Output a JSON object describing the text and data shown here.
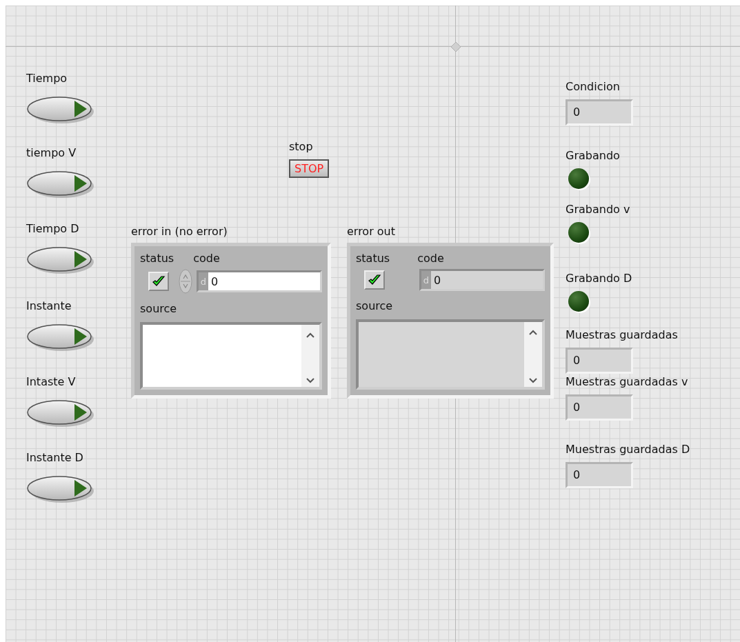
{
  "switches": [
    {
      "label": "Tiempo",
      "on": false
    },
    {
      "label": "tiempo V",
      "on": false
    },
    {
      "label": "Tiempo D",
      "on": false
    },
    {
      "label": "Instante",
      "on": false
    },
    {
      "label": "Intaste V",
      "on": false
    },
    {
      "label": "Instante D",
      "on": false
    }
  ],
  "stop": {
    "label": "stop",
    "text": "STOP"
  },
  "error_clusters": [
    {
      "kind": "control",
      "label": "error in (no error)",
      "status_label": "status",
      "status": true,
      "code_label": "code",
      "radix": "d",
      "code": "0",
      "source_label": "source"
    },
    {
      "kind": "indicator",
      "label": "error out",
      "status_label": "status",
      "status": true,
      "code_label": "code",
      "radix": "d",
      "code": "0",
      "source_label": "source"
    }
  ],
  "indicators": [
    {
      "kind": "numeric",
      "label": "Condicion",
      "value": "0"
    },
    {
      "kind": "led",
      "label": "Grabando",
      "on": false
    },
    {
      "kind": "led",
      "label": "Grabando v",
      "on": false
    },
    {
      "kind": "led",
      "label": "Grabando D",
      "on": false
    },
    {
      "kind": "numeric",
      "label": "Muestras guardadas",
      "value": "0"
    },
    {
      "kind": "numeric",
      "label": "Muestras guardadas v",
      "value": "0"
    },
    {
      "kind": "numeric",
      "label": "Muestras guardadas D",
      "value": "0"
    }
  ]
}
